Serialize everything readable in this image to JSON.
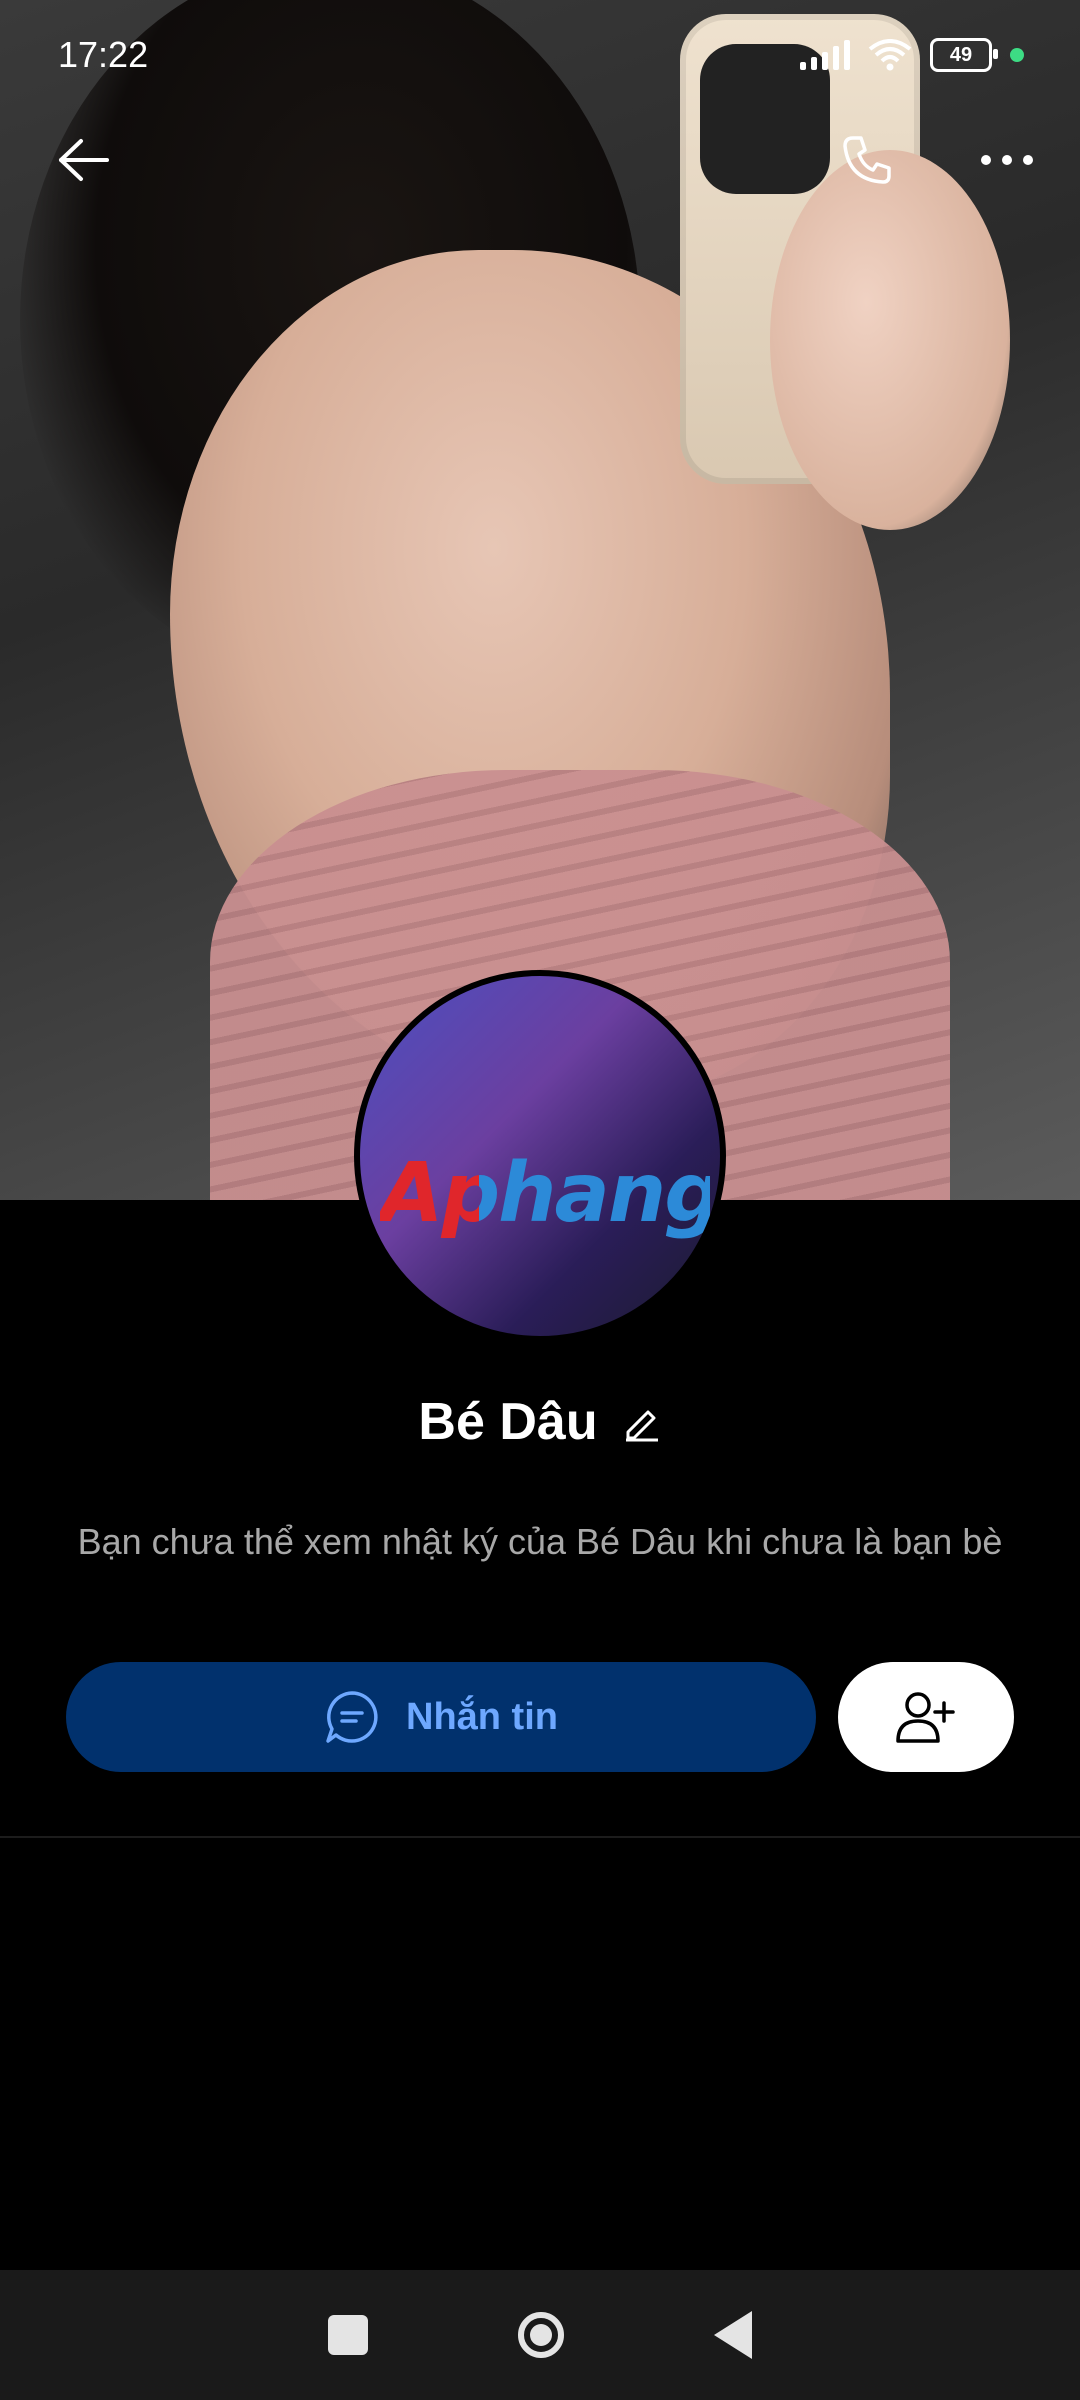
{
  "status_bar": {
    "time": "17:22",
    "battery_level": "49",
    "icons": [
      "signal-icon",
      "wifi-icon",
      "battery-icon",
      "status-dot-icon"
    ]
  },
  "topbar": {
    "icons": [
      "back-arrow-icon",
      "phone-call-icon",
      "more-options-icon"
    ]
  },
  "profile": {
    "avatar_watermark": "Aphang",
    "name": "Bé Dâu",
    "info_text": "Bạn chưa thể xem nhật ký của Bé Dâu khi chưa là bạn bè"
  },
  "actions": {
    "message_label": "Nhắn tin",
    "icons": [
      "chat-bubble-icon",
      "add-friend-icon"
    ]
  },
  "colors": {
    "background": "#000000",
    "message_button_bg": "#01316d",
    "message_button_text": "#6ea8ff",
    "add_button_bg": "#ffffff",
    "info_text": "#a8a8a8",
    "navbar_bg": "#1a1a1a"
  }
}
